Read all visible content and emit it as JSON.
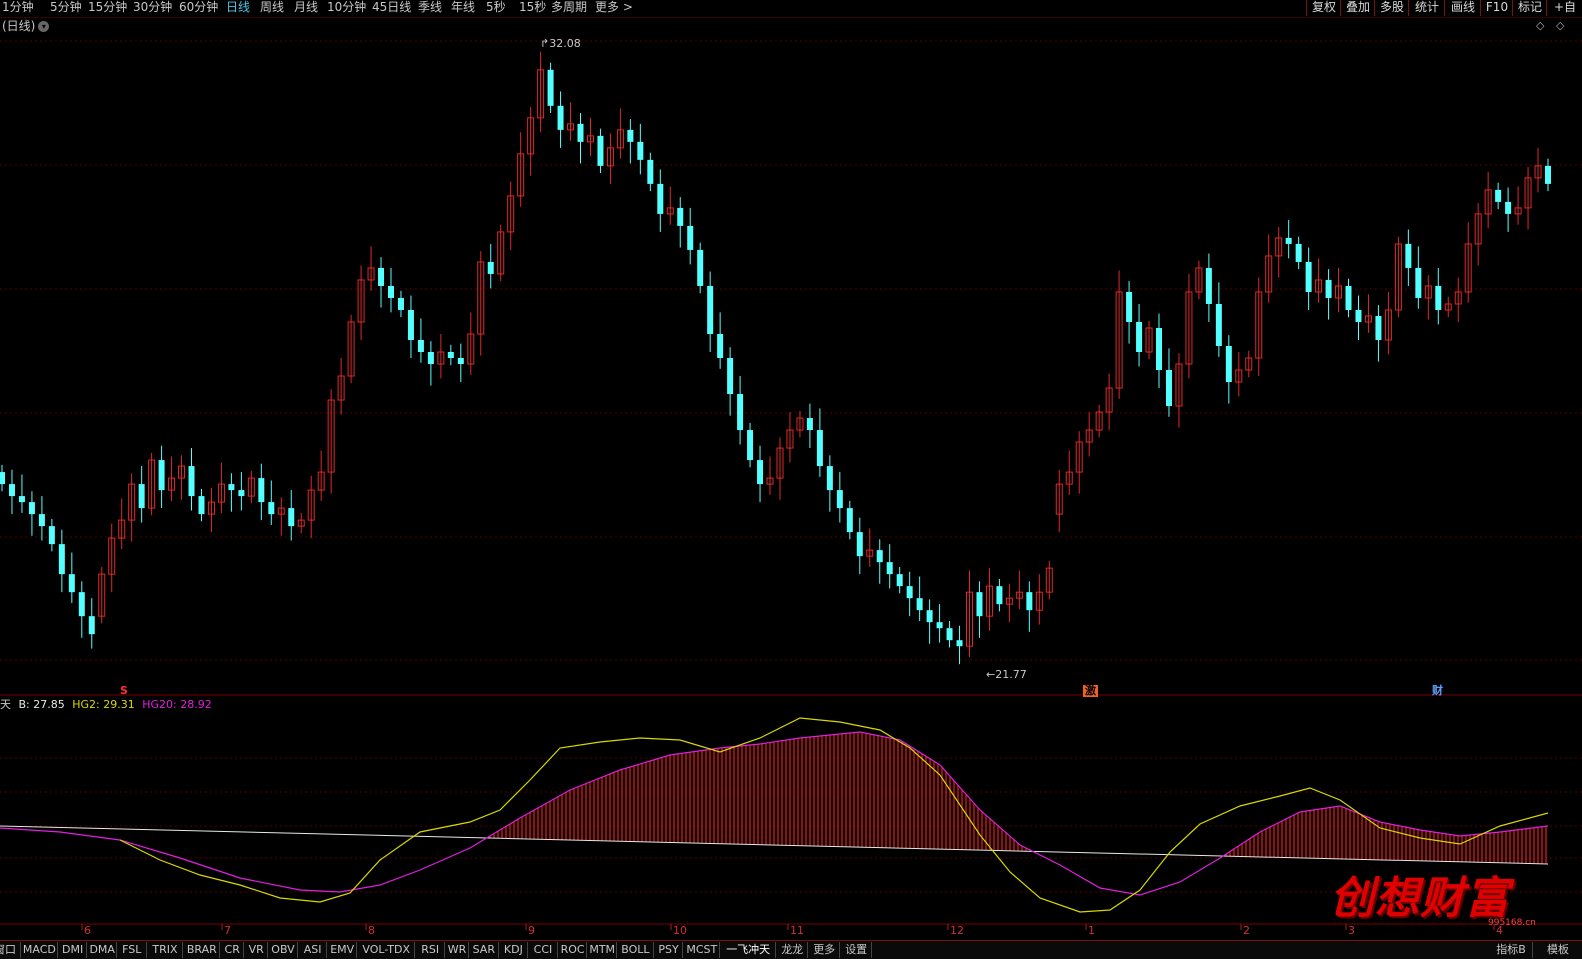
{
  "colors": {
    "bg": "#000000",
    "up": "#e02828",
    "down": "#54ffff",
    "grid": "#5a0000",
    "hg2": "#d8d800",
    "hg20": "#e020e0",
    "base": "#e8e8e8"
  },
  "toolbar": {
    "periods": [
      "1分钟",
      "5分钟",
      "15分钟",
      "30分钟",
      "60分钟",
      "日线",
      "周线",
      "月线",
      "10分钟",
      "45日线",
      "季线",
      "年线",
      "5秒",
      "15秒",
      "多周期",
      "更多 >"
    ],
    "active_period": "日线",
    "right_buttons": [
      "复权",
      "叠加",
      "多股",
      "统计",
      "画线",
      "F10",
      "标记",
      "+自"
    ]
  },
  "main_panel": {
    "title": "(日线)",
    "high_label": "32.08",
    "low_label": "21.77"
  },
  "markers": {
    "s": "S",
    "ji": "激",
    "cai": "财"
  },
  "indicator": {
    "name": "天",
    "b_label": "B: 27.85",
    "hg2_label": "HG2: 29.31",
    "hg20_label": "HG20: 28.92"
  },
  "time_axis": [
    "6",
    "7",
    "8",
    "9",
    "10",
    "11",
    "12",
    "1",
    "2",
    "3",
    "4"
  ],
  "bottom_tabs": [
    "窗口",
    "MACD",
    "DMI",
    "DMA",
    "FSL",
    "TRIX",
    "BRAR",
    "CR",
    "VR",
    "OBV",
    "ASI",
    "EMV",
    "VOL-TDX",
    "RSI",
    "WR",
    "SAR",
    "KDJ",
    "CCI",
    "ROC",
    "MTM",
    "BOLL",
    "PSY",
    "MCST",
    "一飞冲天",
    "龙龙",
    "更多",
    "设置"
  ],
  "bottom_right": [
    "指标B",
    "模板"
  ],
  "watermark": {
    "text": "创想财富",
    "url": "995168.cn"
  },
  "chart_data": [
    {
      "type": "candlestick",
      "title": "(日线)",
      "price_range": [
        21.77,
        32.08
      ],
      "annotations": [
        {
          "label": "32.08",
          "type": "high"
        },
        {
          "label": "21.77",
          "type": "low"
        }
      ],
      "x_ticks": [
        "6",
        "7",
        "8",
        "9",
        "10",
        "11",
        "12",
        "1",
        "2",
        "3",
        "4"
      ],
      "close": [
        24.7,
        24.5,
        24.4,
        24.2,
        24.0,
        23.7,
        23.2,
        22.9,
        22.5,
        22.2,
        23.2,
        23.8,
        24.1,
        24.7,
        24.3,
        25.1,
        24.6,
        24.8,
        25.0,
        24.5,
        24.2,
        24.4,
        24.7,
        24.6,
        24.5,
        24.8,
        24.4,
        24.2,
        24.3,
        24.0,
        24.1,
        24.6,
        24.9,
        26.1,
        26.5,
        27.4,
        28.1,
        28.3,
        28.0,
        27.8,
        27.6,
        27.1,
        26.9,
        26.7,
        26.9,
        26.8,
        26.7,
        27.2,
        28.4,
        28.2,
        28.9,
        29.5,
        30.2,
        30.8,
        31.6,
        31.0,
        30.6,
        30.7,
        30.4,
        30.5,
        30.0,
        30.3,
        30.6,
        30.4,
        30.1,
        29.7,
        29.2,
        29.3,
        29.0,
        28.6,
        28.0,
        27.2,
        26.8,
        26.2,
        25.6,
        25.1,
        24.7,
        24.8,
        25.3,
        25.6,
        25.8,
        25.6,
        25.0,
        24.6,
        24.3,
        23.9,
        23.5,
        23.6,
        23.4,
        23.2,
        23.0,
        22.8,
        22.6,
        22.4,
        22.3,
        22.1,
        22.0,
        22.9,
        22.5,
        23.0,
        22.7,
        22.8,
        22.9,
        22.6,
        22.9,
        23.3,
        24.7,
        24.9,
        25.4,
        25.6,
        25.9,
        26.3,
        27.9,
        27.4,
        26.9,
        27.3,
        26.6,
        26.0,
        26.7,
        27.9,
        28.3,
        27.7,
        27.0,
        26.4,
        26.6,
        26.8,
        27.9,
        28.5,
        28.8,
        28.7,
        28.4,
        27.9,
        28.1,
        27.8,
        28.0,
        27.6,
        27.4,
        27.5,
        27.1,
        27.6,
        28.7,
        28.3,
        27.8,
        28.0,
        27.6,
        27.7,
        27.9,
        28.7,
        29.2,
        29.6,
        29.4,
        29.2,
        29.3,
        29.8,
        30.0,
        29.7
      ],
      "open": [
        24.9,
        24.7,
        24.5,
        24.4,
        24.2,
        24.0,
        23.7,
        23.2,
        22.9,
        22.5,
        22.5,
        23.2,
        23.8,
        24.1,
        24.7,
        24.3,
        25.1,
        24.6,
        24.8,
        25.0,
        24.5,
        24.2,
        24.4,
        24.7,
        24.6,
        24.5,
        24.8,
        24.4,
        24.2,
        24.3,
        24.0,
        24.1,
        24.6,
        24.9,
        26.1,
        26.5,
        27.4,
        28.1,
        28.3,
        28.0,
        27.8,
        27.6,
        27.1,
        26.9,
        26.7,
        26.9,
        26.8,
        26.7,
        27.2,
        28.4,
        28.2,
        28.9,
        29.5,
        30.2,
        30.8,
        31.6,
        31.0,
        30.6,
        30.7,
        30.4,
        30.5,
        30.0,
        30.3,
        30.6,
        30.4,
        30.1,
        29.7,
        29.2,
        29.3,
        29.0,
        28.6,
        28.0,
        27.2,
        26.8,
        26.2,
        25.6,
        25.1,
        24.7,
        24.8,
        25.3,
        25.6,
        25.8,
        25.6,
        25.0,
        24.6,
        24.3,
        23.9,
        23.5,
        23.6,
        23.4,
        23.2,
        23.0,
        22.8,
        22.6,
        22.4,
        22.3,
        22.1,
        22.0,
        22.9,
        22.5,
        23.0,
        22.7,
        22.8,
        22.9,
        22.6,
        22.9,
        24.2,
        24.7,
        24.9,
        25.4,
        25.6,
        25.9,
        26.3,
        27.9,
        27.4,
        26.9,
        27.3,
        26.6,
        26.0,
        26.7,
        27.9,
        28.3,
        27.7,
        27.0,
        26.4,
        26.6,
        26.8,
        27.9,
        28.5,
        28.8,
        28.7,
        28.4,
        27.9,
        28.1,
        27.8,
        28.0,
        27.6,
        27.4,
        27.5,
        27.1,
        27.6,
        28.7,
        28.3,
        27.8,
        28.0,
        27.6,
        27.7,
        27.9,
        28.7,
        29.2,
        29.6,
        29.4,
        29.2,
        29.3,
        29.8,
        30.0
      ]
    },
    {
      "type": "line",
      "series": [
        {
          "name": "B",
          "last": 27.85
        },
        {
          "name": "HG2",
          "last": 29.31
        },
        {
          "name": "HG20",
          "last": 28.92
        }
      ]
    }
  ]
}
